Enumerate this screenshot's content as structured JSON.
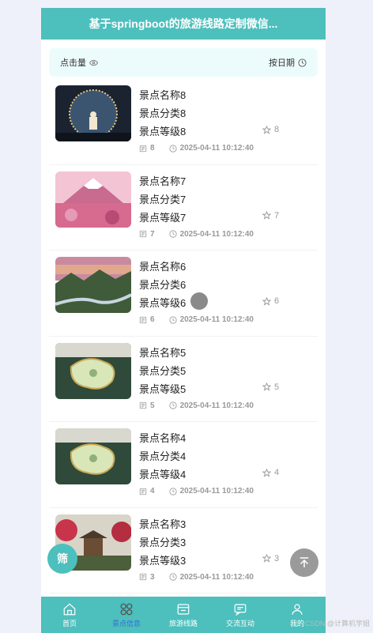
{
  "app": {
    "title": "基于springboot的旅游线路定制微信..."
  },
  "sort": {
    "by_clicks": "点击量",
    "by_date": "按日期"
  },
  "items": [
    {
      "name": "景点名称8",
      "category": "景点分类8",
      "level": "景点等级8",
      "favorites": "8",
      "views": "8",
      "time": "2025-04-11 10:12:40",
      "image": "cave-silhouette"
    },
    {
      "name": "景点名称7",
      "category": "景点分类7",
      "level": "景点等级7",
      "favorites": "7",
      "views": "7",
      "time": "2025-04-11 10:12:40",
      "image": "pink-mountain"
    },
    {
      "name": "景点名称6",
      "category": "景点分类6",
      "level": "景点等级6",
      "favorites": "6",
      "views": "6",
      "time": "2025-04-11 10:12:40",
      "image": "river-valley"
    },
    {
      "name": "景点名称5",
      "category": "景点分类5",
      "level": "景点等级5",
      "favorites": "5",
      "views": "5",
      "time": "2025-04-11 10:12:40",
      "image": "map-art"
    },
    {
      "name": "景点名称4",
      "category": "景点分类4",
      "level": "景点等级4",
      "favorites": "4",
      "views": "4",
      "time": "2025-04-11 10:12:40",
      "image": "map-art"
    },
    {
      "name": "景点名称3",
      "category": "景点分类3",
      "level": "景点等级3",
      "favorites": "3",
      "views": "3",
      "time": "2025-04-11 10:12:40",
      "image": "pavilion"
    }
  ],
  "tabbar": [
    {
      "label": "首页",
      "icon": "home-icon",
      "active": false
    },
    {
      "label": "景点信息",
      "icon": "grid-icon",
      "active": true
    },
    {
      "label": "旅游线路",
      "icon": "route-icon",
      "active": false
    },
    {
      "label": "交流互动",
      "icon": "chat-icon",
      "active": false
    },
    {
      "label": "我的",
      "icon": "user-icon",
      "active": false
    }
  ],
  "filter_button": {
    "label": "筛"
  },
  "watermark": "CSDN @计算机学姐",
  "colors": {
    "primary": "#4dbfbd",
    "active_tab": "#2f6fd6",
    "sort_bar_bg": "#ecfcfc"
  }
}
